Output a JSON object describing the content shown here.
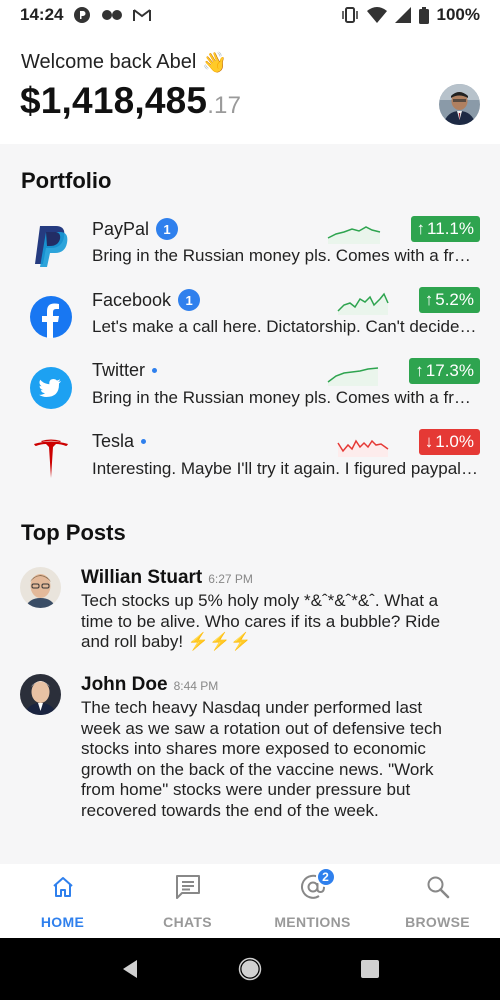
{
  "status_bar": {
    "time": "14:24",
    "battery": "100%"
  },
  "header": {
    "welcome": "Welcome back Abel",
    "wave_emoji": "👋",
    "balance_main": "$1,418,485",
    "balance_cents": ".17"
  },
  "portfolio": {
    "title": "Portfolio",
    "items": [
      {
        "name": "PayPal",
        "badge": "1",
        "change": "11.1%",
        "direction": "up",
        "message": "Bring in the Russian money pls. Comes with a free vodka",
        "logo": "paypal-logo",
        "color": "#2ea44f"
      },
      {
        "name": "Facebook",
        "badge": "1",
        "change": "5.2%",
        "direction": "up",
        "message": "Let's make a call here. Dictatorship. Can't decide on it",
        "logo": "facebook-logo",
        "color": "#2ea44f"
      },
      {
        "name": "Twitter",
        "badge": "",
        "change": "17.3%",
        "direction": "up",
        "message": "Bring in the Russian money pls. Comes with a free vodka",
        "logo": "twitter-logo",
        "color": "#2ea44f"
      },
      {
        "name": "Tesla",
        "badge": "",
        "change": "1.0%",
        "direction": "down",
        "message": "Interesting. Maybe I'll try it again. I figured paypal was",
        "logo": "tesla-logo",
        "color": "#e53935"
      }
    ]
  },
  "top_posts": {
    "title": "Top Posts",
    "posts": [
      {
        "author": "Willian Stuart",
        "time": "6:27 PM",
        "body": "Tech stocks up 5% holy moly *&ˆ*&ˆ*&ˆ. What a time to be alive. Who cares if its a bubble? Ride and roll baby! ⚡⚡⚡"
      },
      {
        "author": "John Doe",
        "time": "8:44 PM",
        "body": "The tech heavy Nasdaq under performed last week as we saw a rotation out of defensive tech stocks into shares more exposed to economic growth on the back of the vaccine news. \"Work from home\" stocks were under pressure but recovered towards the end of the week."
      }
    ]
  },
  "bottom_nav": {
    "home": "HOME",
    "chats": "CHATS",
    "mentions": "MENTIONS",
    "mentions_badge": "2",
    "browse": "BROWSE"
  },
  "colors": {
    "accent": "#2f80ed",
    "up": "#2ea44f",
    "down": "#e53935"
  }
}
